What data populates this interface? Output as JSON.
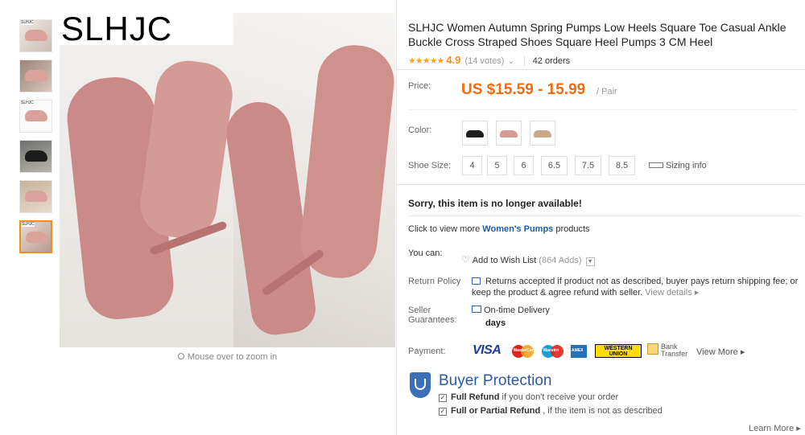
{
  "brand_overlay": "SLHJC",
  "thumbnails": [
    {
      "label": "SLHJC"
    },
    {
      "label": ""
    },
    {
      "label": "SLHJC"
    },
    {
      "label": ""
    },
    {
      "label": ""
    },
    {
      "label": "SLHJC"
    }
  ],
  "zoom_hint": "Mouse over to zoom in",
  "product": {
    "title": "SLHJC Women Autumn Spring Pumps Low Heels Square Toe Casual Ankle Buckle Cross Straped Shoes Square Heel Pumps 3 CM Heel",
    "stars": "★★★★★",
    "rating": "4.9",
    "votes": "(14 votes)",
    "orders": "42 orders"
  },
  "price": {
    "label": "Price:",
    "value": "US $15.59 - 15.99",
    "unit": "/ Pair"
  },
  "color": {
    "label": "Color:",
    "options": [
      {
        "name": "black",
        "color": "#1e1e1e"
      },
      {
        "name": "pink",
        "color": "#d59a94"
      },
      {
        "name": "beige",
        "color": "#c9a98c"
      }
    ]
  },
  "shoe_size": {
    "label": "Shoe Size:",
    "options": [
      "4",
      "5",
      "6",
      "6.5",
      "7.5",
      "8.5"
    ],
    "sizing_info": "Sizing info"
  },
  "availability": "Sorry, this item is no longer available!",
  "more_category": {
    "prefix": "Click to view more ",
    "link": "Women's Pumps",
    "suffix": " products"
  },
  "you_can": {
    "label": "You can:",
    "wish_text": "Add to Wish List",
    "wish_count": "(864 Adds)"
  },
  "return_policy": {
    "label": "Return Policy",
    "text": "Returns accepted if product not as described, buyer pays return shipping fee; or keep the product & agree refund with seller.",
    "link": "View details ▸"
  },
  "seller_guarantees": {
    "label": "Seller Guarantees:",
    "delivery": "On-time Delivery",
    "days": "days"
  },
  "payment": {
    "label": "Payment:",
    "visa": "VISA",
    "mastercard": "MasterCard",
    "maestro": "Maestro",
    "amex": "AMEX",
    "western_union": "WESTERN UNION",
    "bank_transfer_1": "Bank",
    "bank_transfer_2": "Transfer",
    "view_more": "View More ▸"
  },
  "buyer_protection": {
    "title": "Buyer Protection",
    "line1_bold": "Full Refund",
    "line1_rest": " if you don't receive your order",
    "line2_bold": "Full or Partial Refund",
    "line2_rest": " , if the item is not as described",
    "learn_more": "Learn More ▸"
  },
  "colors": {
    "price": "#f46a0d",
    "rating": "#f48e1a",
    "link": "#1a5dad",
    "protection": "#2a5aa5",
    "active_thumb": "#f48e1a"
  }
}
